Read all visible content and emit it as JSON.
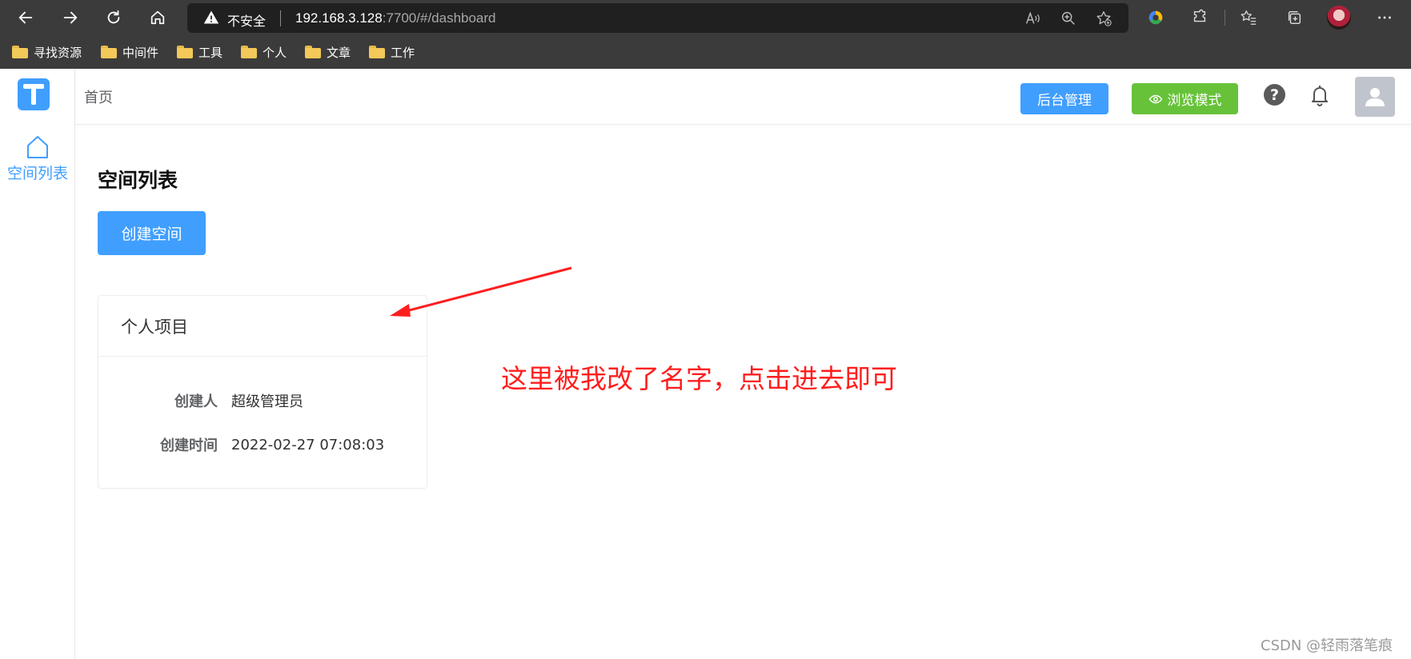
{
  "browser": {
    "insecure_label": "不安全",
    "url_host": "192.168.3.128",
    "url_rest": ":7700/#/dashboard",
    "bookmarks": [
      "寻找资源",
      "中间件",
      "工具",
      "个人",
      "文章",
      "工作"
    ]
  },
  "app": {
    "breadcrumb": "首页",
    "sidebar": {
      "items": [
        {
          "label": "空间列表",
          "icon": "home-icon"
        }
      ]
    },
    "header": {
      "admin_button": "后台管理",
      "browse_button": "浏览模式",
      "help_icon_glyph": "?"
    },
    "main": {
      "title": "空间列表",
      "create_button": "创建空间",
      "card": {
        "title": "个人项目",
        "rows": [
          {
            "label": "创建人",
            "value": "超级管理员"
          },
          {
            "label": "创建时间",
            "value": "2022-02-27 07:08:03"
          }
        ]
      }
    }
  },
  "annotation": {
    "text": "这里被我改了名字，点击进去即可"
  },
  "watermark": "CSDN @轻雨落笔痕",
  "colors": {
    "primary": "#409eff",
    "success": "#67c23a",
    "annotation": "#ff1e1e",
    "chrome": "#3b3b3b"
  }
}
